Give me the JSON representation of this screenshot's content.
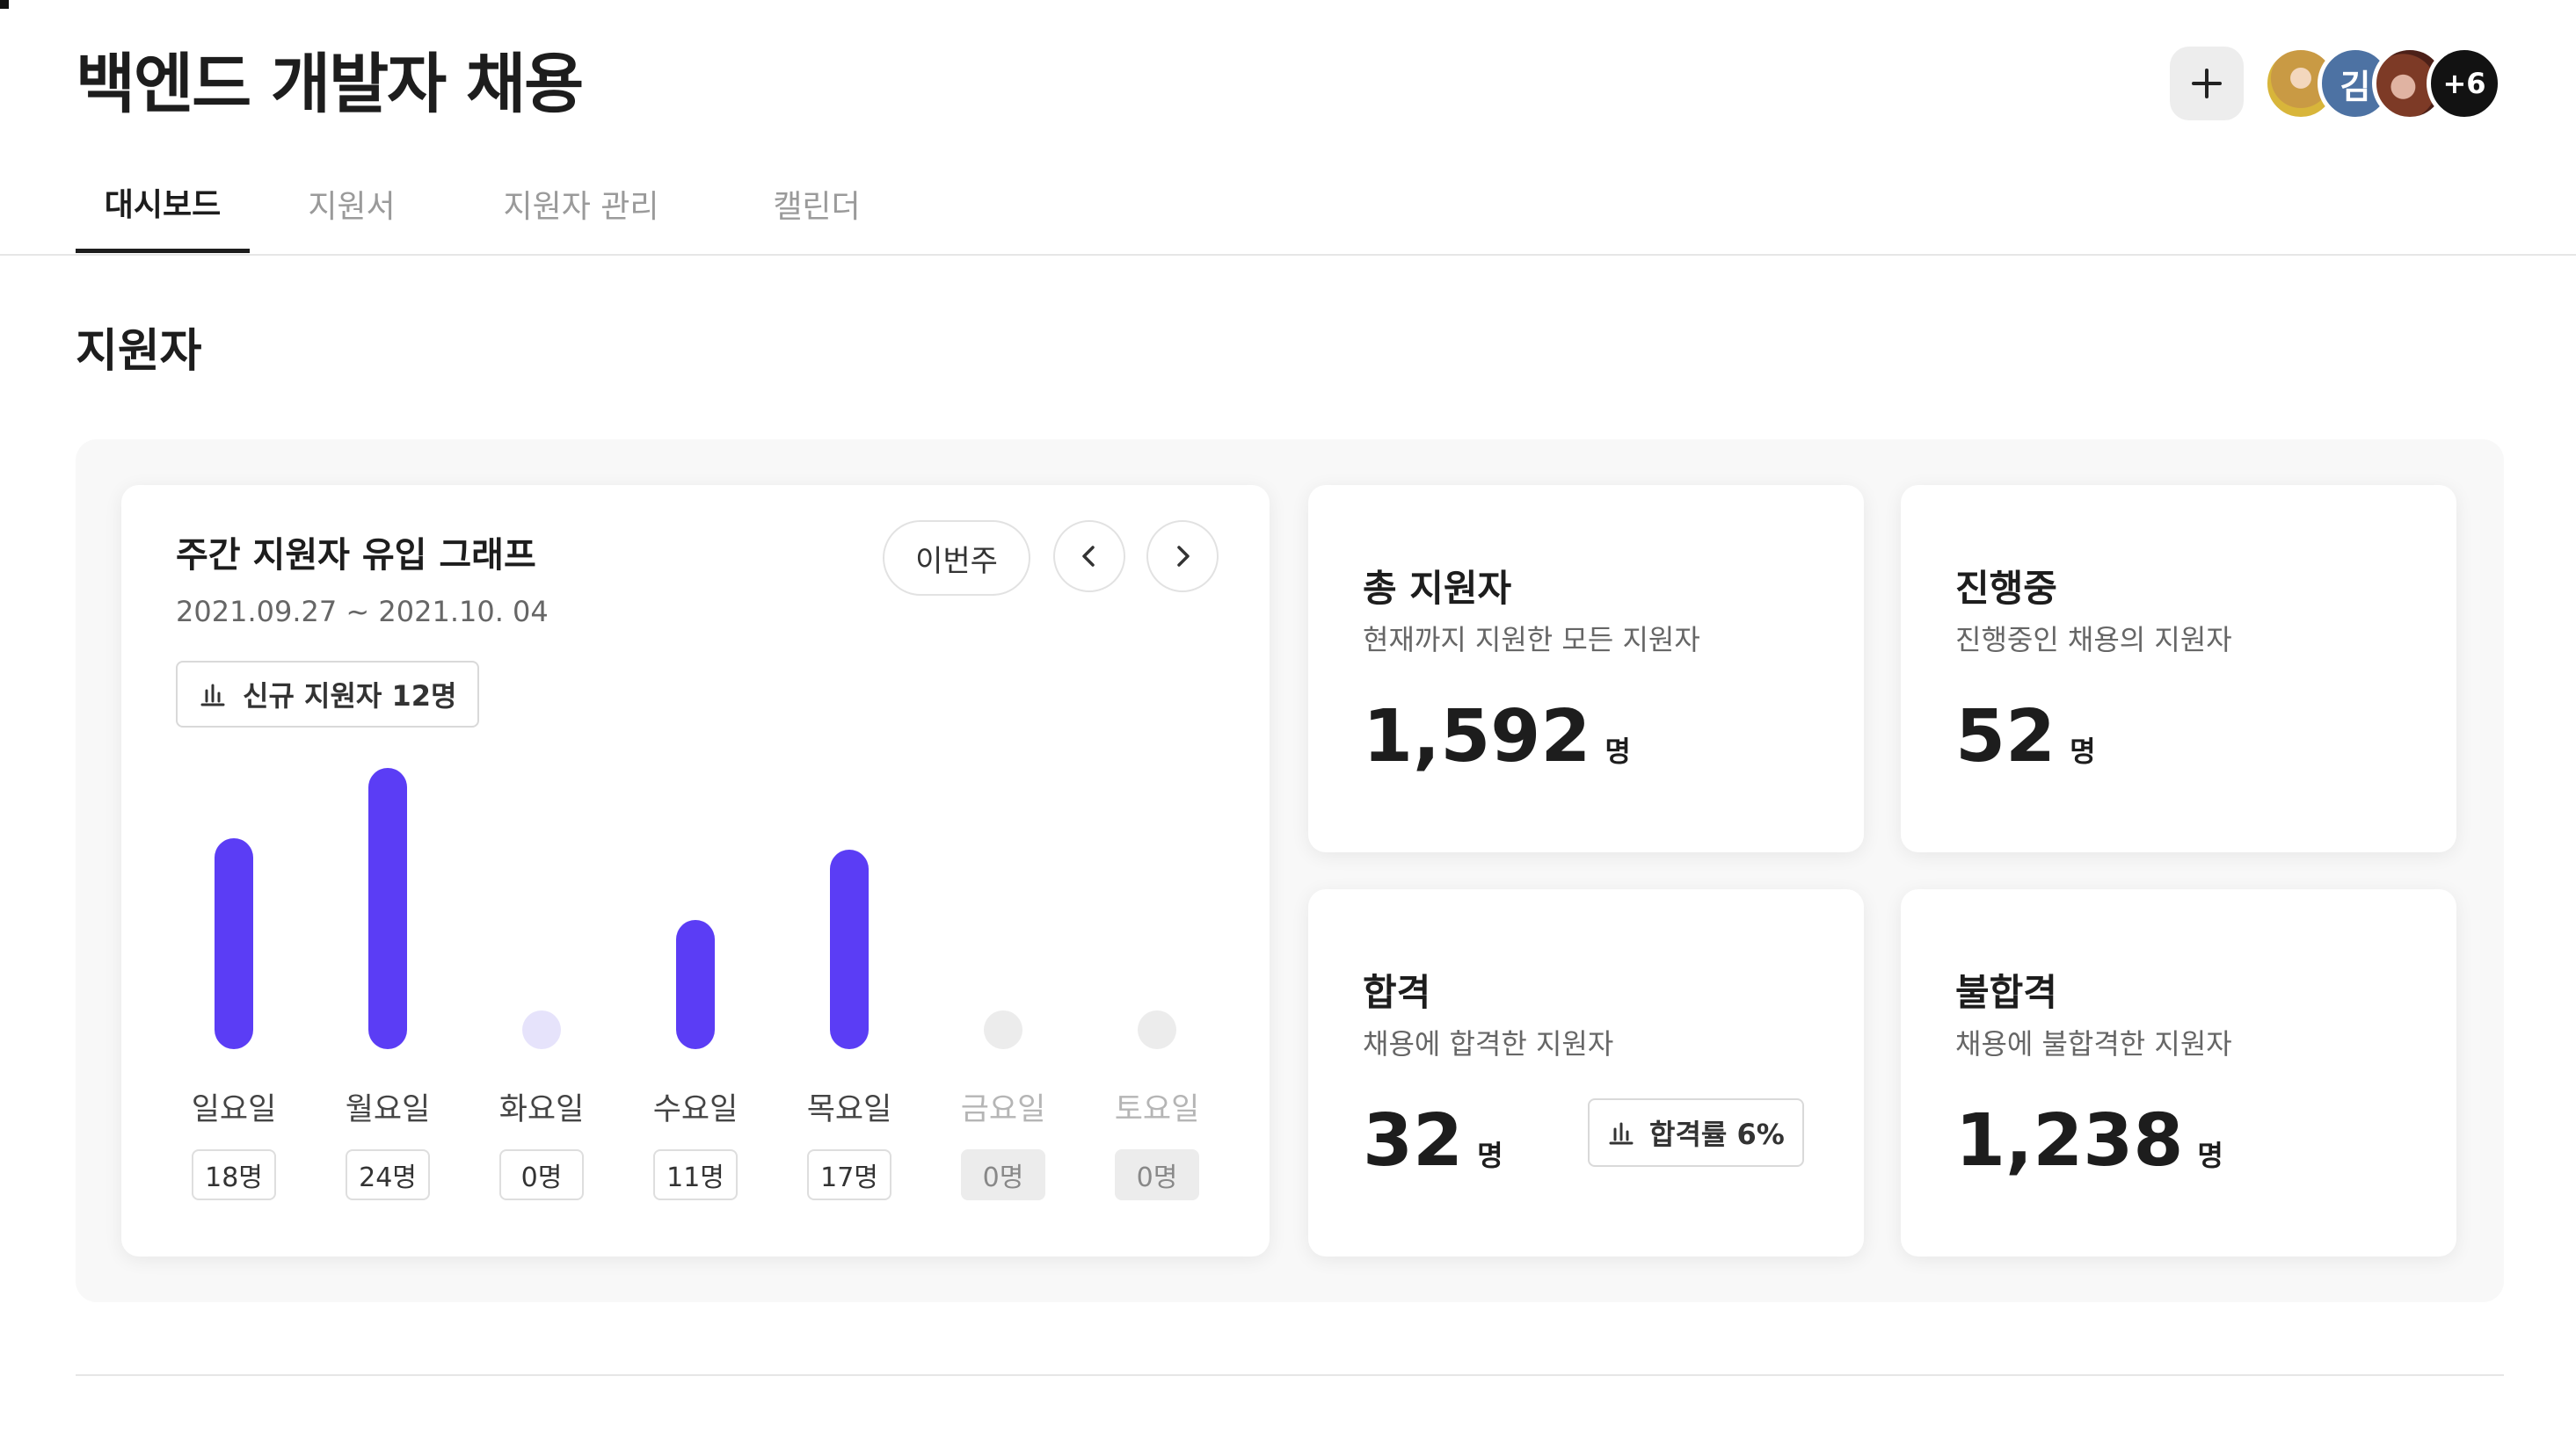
{
  "header": {
    "title": "백엔드 개발자 채용",
    "add_label": "+",
    "avatars": [
      {
        "label": ""
      },
      {
        "label": "김"
      },
      {
        "label": ""
      },
      {
        "label": "+6"
      }
    ]
  },
  "tabs": [
    {
      "label": "대시보드",
      "active": true
    },
    {
      "label": "지원서",
      "active": false
    },
    {
      "label": "지원자 관리",
      "active": false
    },
    {
      "label": "캘린더",
      "active": false
    }
  ],
  "section_title": "지원자",
  "graph": {
    "title": "주간 지원자 유입 그래프",
    "range": "2021.09.27 ~ 2021.10. 04",
    "new_applicants": "신규 지원자 12명",
    "week_button": "이번주",
    "bar_color": "#5b3df5",
    "empty_color": "#e6e3fb",
    "inactive_color": "#ececec"
  },
  "chart_data": {
    "type": "bar",
    "categories": [
      "일요일",
      "월요일",
      "화요일",
      "수요일",
      "목요일",
      "금요일",
      "토요일"
    ],
    "values": [
      18,
      24,
      0,
      11,
      17,
      0,
      0
    ],
    "count_labels": [
      "18명",
      "24명",
      "0명",
      "11명",
      "17명",
      "0명",
      "0명"
    ],
    "inactive": [
      false,
      false,
      false,
      false,
      false,
      true,
      true
    ]
  },
  "stats": {
    "total": {
      "title": "총 지원자",
      "sub": "현재까지 지원한 모든 지원자",
      "value": "1,592",
      "unit": "명"
    },
    "in_progress": {
      "title": "진행중",
      "sub": "진행중인 채용의 지원자",
      "value": "52",
      "unit": "명"
    },
    "passed": {
      "title": "합격",
      "sub": "채용에 합격한 지원자",
      "value": "32",
      "unit": "명",
      "rate": "합격률 6%"
    },
    "failed": {
      "title": "불합격",
      "sub": "채용에 불합격한 지원자",
      "value": "1,238",
      "unit": "명"
    }
  }
}
